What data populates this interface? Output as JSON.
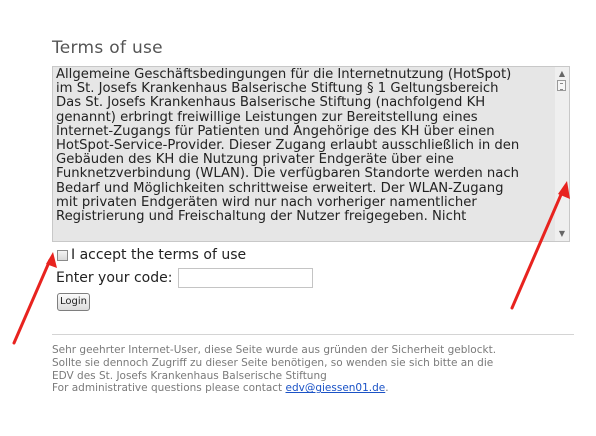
{
  "header": {
    "title": "Terms of use"
  },
  "terms": {
    "text": "Allgemeine Geschäftsbedingungen für die Internetnutzung (HotSpot)\nim St. Josefs Krankenhaus Balserische Stiftung § 1 Geltungsbereich\nDas St. Josefs Krankenhaus Balserische Stiftung (nachfolgend KH\ngenannt) erbringt freiwillige Leistungen zur Bereitstellung eines\nInternet-Zugangs für Patienten und Angehörige des KH über einen\nHotSpot-Service-Provider. Dieser Zugang erlaubt ausschließlich in den\nGebäuden des KH die Nutzung privater Endgeräte über eine\nFunknetzverbindung (WLAN). Die verfügbaren Standorte werden nach\nBedarf und Möglichkeiten schrittweise erweitert. Der WLAN-Zugang\nmit privaten Endgeräten wird nur nach vorheriger namentlicher\nRegistrierung und Freischaltung der Nutzer freigegeben. Nicht",
    "scroll_up_icon": "▲",
    "scroll_down_icon": "▼"
  },
  "form": {
    "accept_label": "I accept the terms of use",
    "accept_checked": false,
    "code_label": "Enter your code:",
    "code_value": "",
    "login_label": "Login"
  },
  "footer": {
    "line1": "Sehr geehrter Internet-User, diese Seite wurde aus gründen der Sicherheit geblockt.",
    "line2": "Sollte sie dennoch Zugriff zu dieser Seite benötigen, so wenden sie sich bitte an die",
    "line3": "EDV des St. Josefs Krankenhaus Balserische Stiftung",
    "line4_prefix": "For administrative questions please contact ",
    "email": "edv@giessen01.de",
    "line4_suffix": "."
  },
  "colors": {
    "annotation_arrow": "#e8231f",
    "link": "#1a52c6",
    "terms_background": "#e6e6e6"
  }
}
